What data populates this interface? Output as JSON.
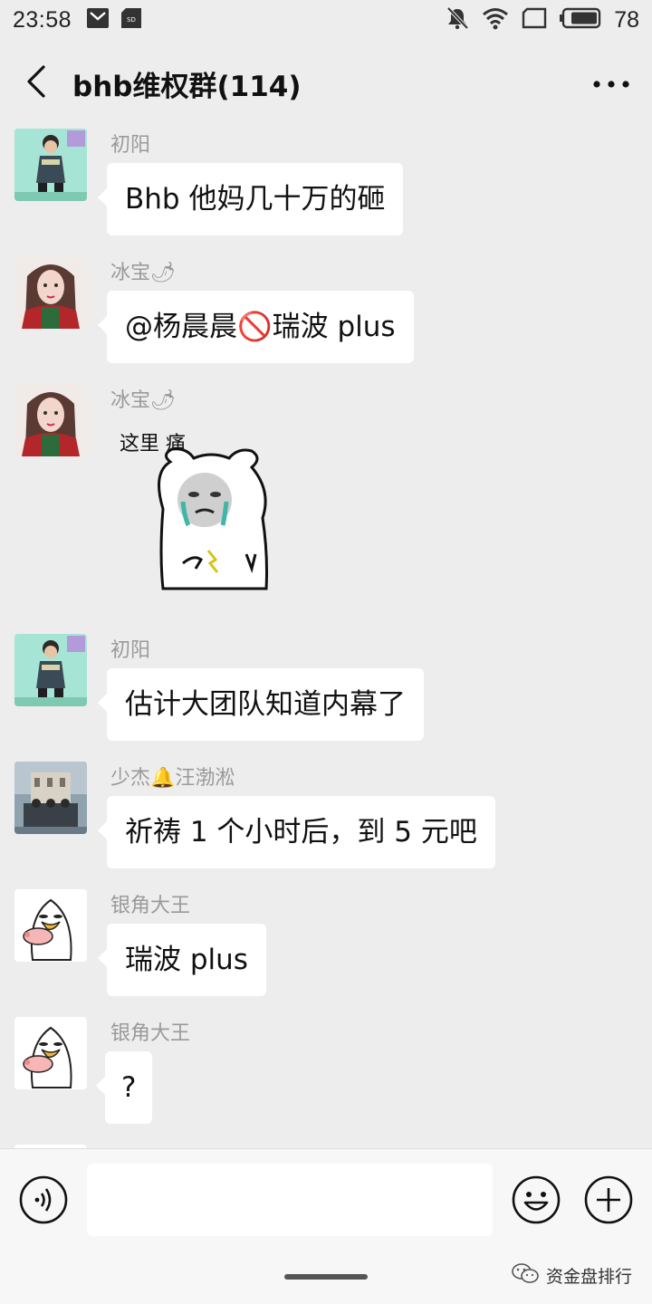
{
  "status_bar": {
    "time": "23:58",
    "battery": "78",
    "icons": [
      "message-icon",
      "sd-card-icon",
      "mute-icon",
      "wifi-icon",
      "screen-icon",
      "battery-icon"
    ]
  },
  "header": {
    "title": "bhb维权群(114)"
  },
  "messages": [
    {
      "sender": "初阳",
      "text": "Bhb 他妈几十万的砸"
    },
    {
      "sender": "冰宝🌶",
      "text": "@杨晨晨🚫瑞波 plus"
    },
    {
      "sender": "冰宝🌶",
      "sticker_caption": "这里 痛"
    },
    {
      "sender": "初阳",
      "text": "估计大团队知道内幕了"
    },
    {
      "sender": "少杰🔔汪渤淞",
      "text": "祈祷 1 个小时后，到 5 元吧"
    },
    {
      "sender": "银角大王",
      "text": "瑞波 plus"
    },
    {
      "sender": "银角大王",
      "text": "?"
    }
  ],
  "input_bar": {
    "placeholder": ""
  },
  "watermark": {
    "text": "资金盘排行"
  },
  "colors": {
    "background": "#ededed",
    "bubble": "#ffffff",
    "sender_name": "#9a9a9a"
  }
}
